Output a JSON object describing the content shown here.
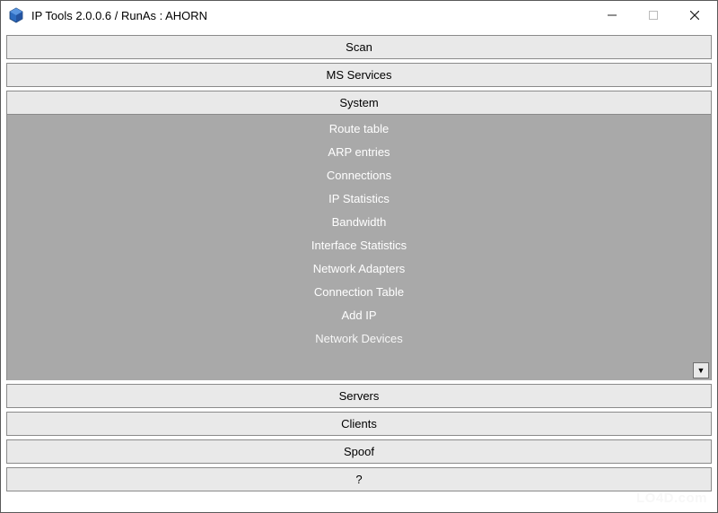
{
  "titlebar": {
    "title": "IP Tools 2.0.0.6 / RunAs : AHORN"
  },
  "sections": {
    "scan": "Scan",
    "ms_services": "MS Services",
    "system": "System",
    "servers": "Servers",
    "clients": "Clients",
    "spoof": "Spoof",
    "help": "?"
  },
  "system_items": [
    "Route table",
    "ARP entries",
    "Connections",
    "IP Statistics",
    "Bandwidth",
    "Interface Statistics",
    "Network Adapters",
    "Connection Table",
    "Add IP",
    "Network Devices"
  ],
  "watermark": "LO4D.com",
  "icons": {
    "dropdown": "▼"
  }
}
